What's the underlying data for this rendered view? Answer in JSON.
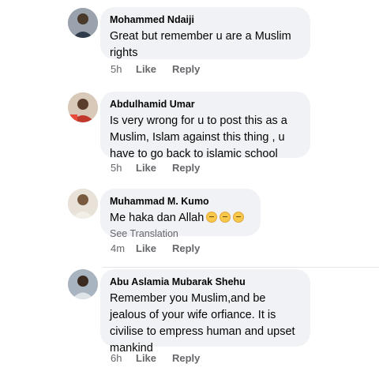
{
  "comments": [
    {
      "author": "Mohammed Ndaiji",
      "text": "Great but remember u are a Muslim\nrights",
      "time": "5h",
      "like_label": "Like",
      "reply_label": "Reply"
    },
    {
      "author": "Abdulhamid Umar",
      "text": "Is very wrong for u to post this as a\nMuslim, Islam against this thing , u\nhave to go back to islamic school",
      "time": "5h",
      "like_label": "Like",
      "reply_label": "Reply"
    },
    {
      "author": "Muhammad M. Kumo",
      "text": "Me haka dan Allah",
      "emojis": [
        "😔",
        "😔",
        "😔"
      ],
      "see_translation": "See Translation",
      "time": "4m",
      "like_label": "Like",
      "reply_label": "Reply"
    },
    {
      "author": "Abu Aslamia Mubarak Shehu",
      "text": "Remember you Muslim,and be\njealous of your wife orfiance. It is\ncivilise to empress human and upset\nmankind",
      "time": "6h",
      "like_label": "Like",
      "reply_label": "Reply"
    }
  ]
}
